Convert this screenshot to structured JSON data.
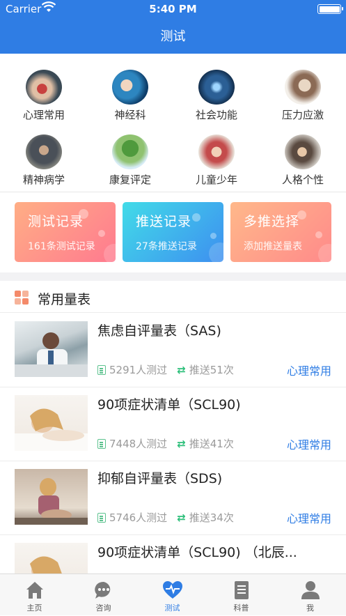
{
  "status_bar": {
    "carrier": "Carrier",
    "time": "5:40 PM"
  },
  "nav": {
    "title": "测试"
  },
  "categories": [
    {
      "label": "心理常用",
      "photo": "heart-hands"
    },
    {
      "label": "神经科",
      "photo": "brain-scan"
    },
    {
      "label": "社会功能",
      "photo": "network"
    },
    {
      "label": "压力应激",
      "photo": "stressed-worker"
    },
    {
      "label": "精神病学",
      "photo": "elderly-man"
    },
    {
      "label": "康复评定",
      "photo": "tree"
    },
    {
      "label": "儿童少年",
      "photo": "children"
    },
    {
      "label": "人格个性",
      "photo": "person-glasses"
    }
  ],
  "action_cards": [
    {
      "title": "测试记录",
      "subtitle": "161条测试记录"
    },
    {
      "title": "推送记录",
      "subtitle": "27条推送记录"
    },
    {
      "title": "多推选择",
      "subtitle": "添加推送量表"
    }
  ],
  "section": {
    "title": "常用量表"
  },
  "scales": [
    {
      "name": "焦虑自评量表（SAS)",
      "tests": "5291人测过",
      "pushes": "推送51次",
      "tag": "心理常用"
    },
    {
      "name": "90项症状清单（SCL90)",
      "tests": "7448人测过",
      "pushes": "推送41次",
      "tag": "心理常用"
    },
    {
      "name": "抑郁自评量表（SDS)",
      "tests": "5746人测过",
      "pushes": "推送34次",
      "tag": "心理常用"
    },
    {
      "name": "90项症状清单（SCL90) （北辰...",
      "tests": "",
      "pushes": "",
      "tag": ""
    }
  ],
  "tabs": [
    {
      "label": "主页",
      "icon": "home-icon"
    },
    {
      "label": "咨询",
      "icon": "chat-icon"
    },
    {
      "label": "测试",
      "icon": "heart-pulse-icon"
    },
    {
      "label": "科普",
      "icon": "document-icon"
    },
    {
      "label": "我",
      "icon": "person-icon"
    }
  ],
  "colors": {
    "primary": "#2f7de4",
    "accent_green": "#2dbf7a"
  }
}
